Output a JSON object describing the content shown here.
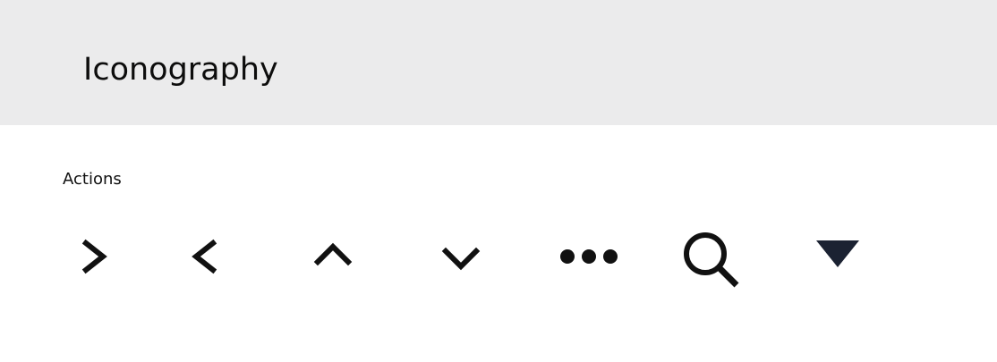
{
  "header": {
    "title": "Iconography",
    "background": "#ebebec"
  },
  "section": {
    "title": "Actions"
  },
  "icons": [
    {
      "name": "chevron-right-icon"
    },
    {
      "name": "chevron-left-icon"
    },
    {
      "name": "chevron-up-icon"
    },
    {
      "name": "chevron-down-icon"
    },
    {
      "name": "more-horizontal-icon"
    },
    {
      "name": "search-icon"
    },
    {
      "name": "caret-down-icon"
    }
  ],
  "colors": {
    "icon": "#111111",
    "caret": "#1b2232"
  }
}
